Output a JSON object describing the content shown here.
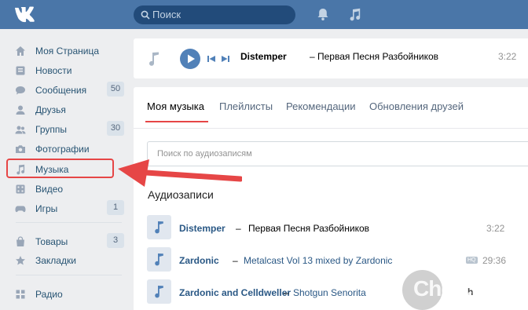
{
  "topbar": {
    "search_placeholder": "Поиск",
    "colors": {
      "bar": "#4a76a8",
      "search": "#224b7a"
    }
  },
  "sidebar": {
    "items": [
      {
        "label": "Моя Страница",
        "icon": "home-icon"
      },
      {
        "label": "Новости",
        "icon": "news-icon"
      },
      {
        "label": "Сообщения",
        "icon": "messages-icon",
        "count": "50"
      },
      {
        "label": "Друзья",
        "icon": "friends-icon"
      },
      {
        "label": "Группы",
        "icon": "groups-icon",
        "count": "30"
      },
      {
        "label": "Фотографии",
        "icon": "camera-icon"
      },
      {
        "label": "Музыка",
        "icon": "music-icon"
      },
      {
        "label": "Видео",
        "icon": "video-icon"
      },
      {
        "label": "Игры",
        "icon": "games-icon",
        "count": "1"
      },
      {
        "label": "Товары",
        "icon": "shopping-bag-icon",
        "count": "3"
      },
      {
        "label": "Закладки",
        "icon": "star-icon"
      },
      {
        "label": "Радио",
        "icon": "radio-icon"
      }
    ]
  },
  "player": {
    "artist": "Distemper",
    "title": "– Первая Песня Разбойников",
    "duration": "3:22"
  },
  "tabs": [
    {
      "label": "Моя музыка",
      "active": true
    },
    {
      "label": "Плейлисты"
    },
    {
      "label": "Рекомендации"
    },
    {
      "label": "Обновления друзей"
    }
  ],
  "audio_search": {
    "placeholder": "Поиск по аудиозаписям"
  },
  "section_title": "Аудиозаписи",
  "tracks": [
    {
      "artist": "Distemper",
      "title": "Первая Песня Разбойников",
      "duration": "3:22",
      "title_color": "#000000"
    },
    {
      "artist": "Zardonic",
      "title": "Metalcast Vol 13 mixed by Zardonic",
      "duration": "29:36",
      "badge": "HQ",
      "title_color": "#2a5885"
    },
    {
      "artist": "Zardonic and Celldweller",
      "title": "Shotgun Senorita",
      "duration": "",
      "badge2": "h",
      "title_color": "#2a5885"
    }
  ],
  "watermark": "Cho-cho.ru",
  "accent": "#e64646"
}
